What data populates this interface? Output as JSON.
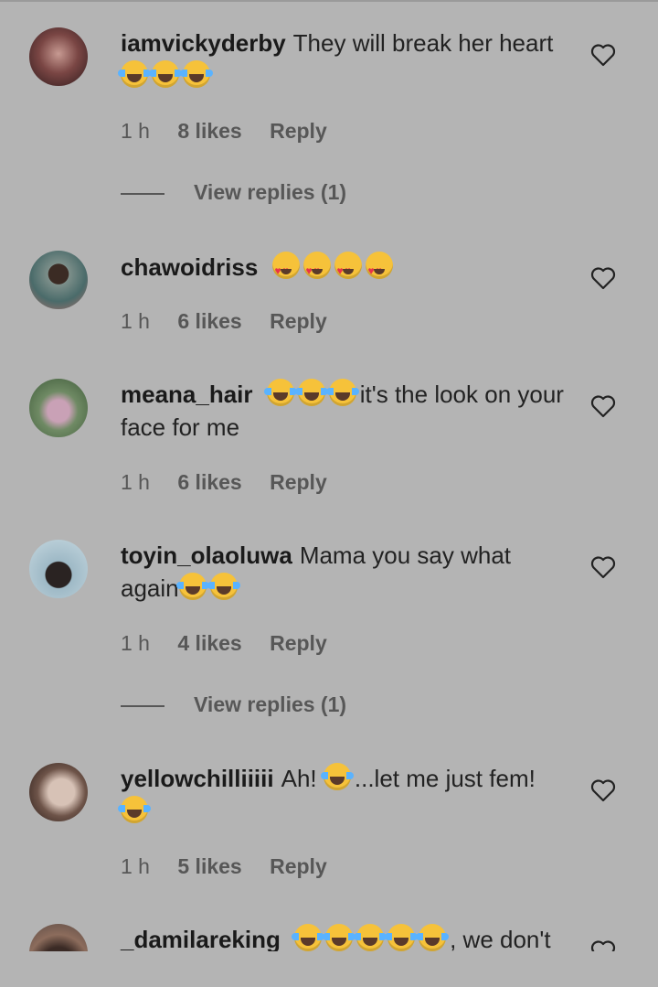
{
  "comments": [
    {
      "user": "iamvickyderby",
      "text": "They will break her heart",
      "emojis": [
        "face-with-tears-of-joy",
        "face-with-tears-of-joy",
        "face-with-tears-of-joy"
      ],
      "time": "1 h",
      "likes": "8 likes",
      "reply": "Reply",
      "view_replies": "View replies (1)"
    },
    {
      "user": "chawoidriss",
      "text": "",
      "emojis": [
        "smiling-face-with-heart-eyes",
        "smiling-face-with-heart-eyes",
        "smiling-face-with-heart-eyes",
        "smiling-face-with-heart-eyes"
      ],
      "time": "1 h",
      "likes": "6 likes",
      "reply": "Reply"
    },
    {
      "user": "meana_hair",
      "text_after": "it's the look on your face for me",
      "emojis": [
        "face-with-tears-of-joy",
        "face-with-tears-of-joy",
        "face-with-tears-of-joy"
      ],
      "time": "1 h",
      "likes": "6 likes",
      "reply": "Reply"
    },
    {
      "user": "toyin_olaoluwa",
      "text": "Mama you say what again",
      "emojis": [
        "face-with-tears-of-joy",
        "face-with-tears-of-joy"
      ],
      "time": "1 h",
      "likes": "4 likes",
      "reply": "Reply",
      "view_replies": "View replies (1)"
    },
    {
      "user": "yellowchilliiiii",
      "text_before": "Ah!",
      "text_after": "...let me just fem!",
      "emojis": [
        "face-with-tears-of-joy",
        "face-with-tears-of-joy"
      ],
      "time": "1 h",
      "likes": "5 likes",
      "reply": "Reply"
    },
    {
      "user": "_damilareking",
      "text_after": ", we don't",
      "emojis": [
        "face-with-tears-of-joy",
        "face-with-tears-of-joy",
        "face-with-tears-of-joy",
        "face-with-tears-of-joy",
        "face-with-tears-of-joy"
      ]
    }
  ],
  "icons": {
    "like": "heart-outline-icon"
  },
  "colors": {
    "background": "#b4b4b4",
    "meta_text": "#575757",
    "emoji": "#f6c23a"
  }
}
